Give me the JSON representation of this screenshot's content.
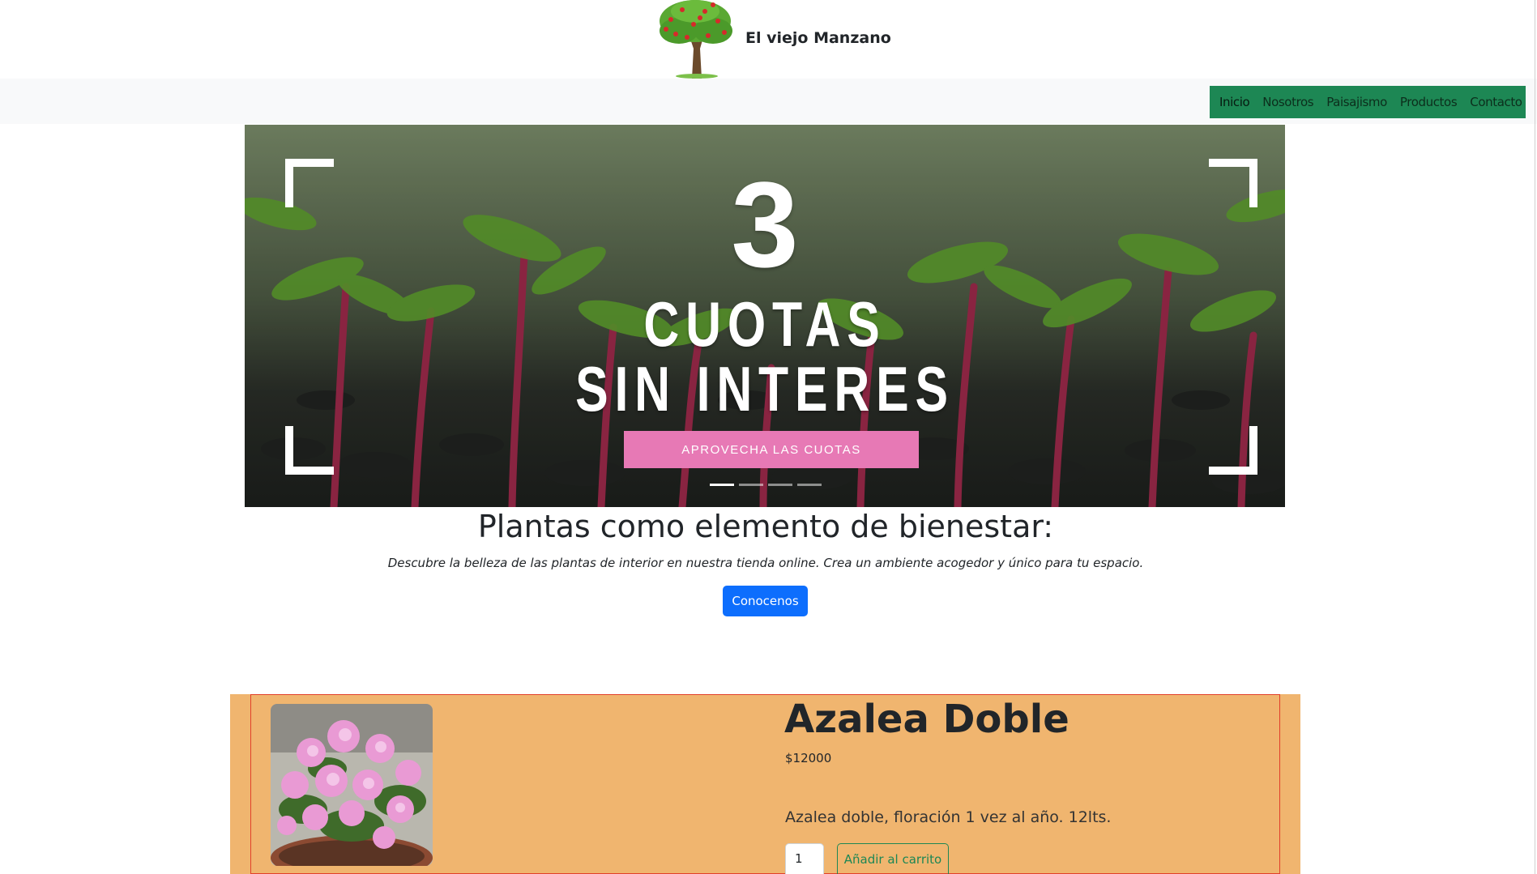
{
  "header": {
    "brand": "El viejo Manzano",
    "logo_icon": "apple-tree-logo-icon"
  },
  "nav": {
    "items": [
      {
        "label": "Inicio",
        "active": true
      },
      {
        "label": "Nosotros",
        "active": false
      },
      {
        "label": "Paisajismo",
        "active": false
      },
      {
        "label": "Productos",
        "active": false
      },
      {
        "label": "Contacto",
        "active": false
      }
    ],
    "background_color": "#1d8754"
  },
  "carousel": {
    "slide": {
      "number": "3",
      "line1": "CUOTAS",
      "line2": "SIN INTERES",
      "button_label": "APROVECHA LAS CUOTAS",
      "button_color": "#e779b5"
    },
    "indicator_count": 4,
    "active_index": 0
  },
  "hero": {
    "title": "Plantas como elemento de bienestar:",
    "subtitle": "Descubre la belleza de las plantas de interior en nuestra tienda online. Crea un ambiente acogedor y único para tu espacio.",
    "cta_label": "Conocenos",
    "cta_color": "#0d6efd"
  },
  "product": {
    "name": "Azalea Doble",
    "price": "$12000",
    "description": "Azalea doble, floración 1 vez al año. 12lts.",
    "quantity": "1",
    "add_label": "Añadir al carrito",
    "section_color": "#f0b56f",
    "image_icon": "azalea-photo"
  }
}
